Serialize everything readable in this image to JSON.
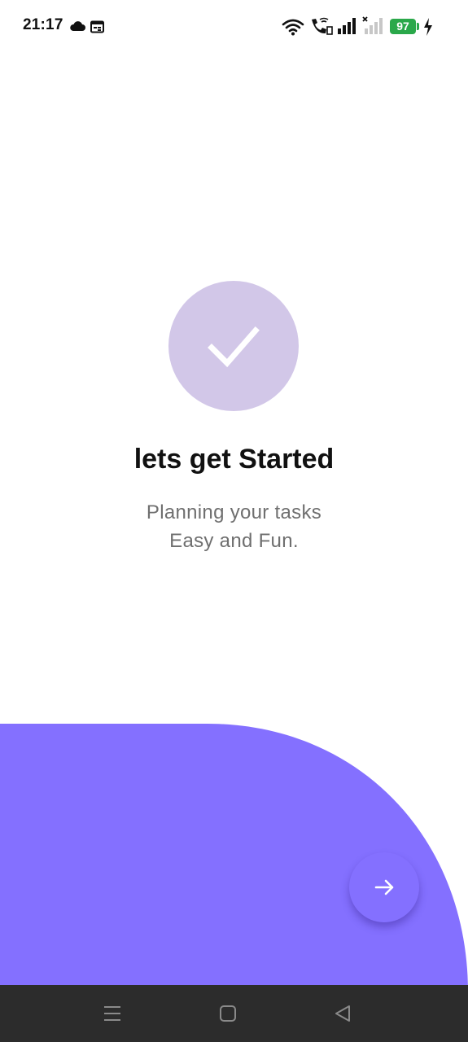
{
  "status_bar": {
    "time": "21:17",
    "battery_level": "97",
    "icons": [
      "cloud-icon",
      "calendar-icon",
      "wifi-icon",
      "wifi-call-icon",
      "signal-icon",
      "signal-no-service-icon",
      "battery-icon",
      "charging-icon"
    ]
  },
  "hero": {
    "icon": "checkmark-icon",
    "title": "lets get Started",
    "subtitle_line1": "Planning your tasks",
    "subtitle_line2": "Easy and Fun."
  },
  "actions": {
    "next_icon": "arrow-right-icon"
  },
  "nav_bar": {
    "items": [
      "menu-icon",
      "home-icon",
      "back-icon"
    ]
  },
  "colors": {
    "accent": "#8470ff",
    "circle": "#d2c7e8",
    "battery": "#2aa84a",
    "nav_bar": "#2c2c2c"
  }
}
